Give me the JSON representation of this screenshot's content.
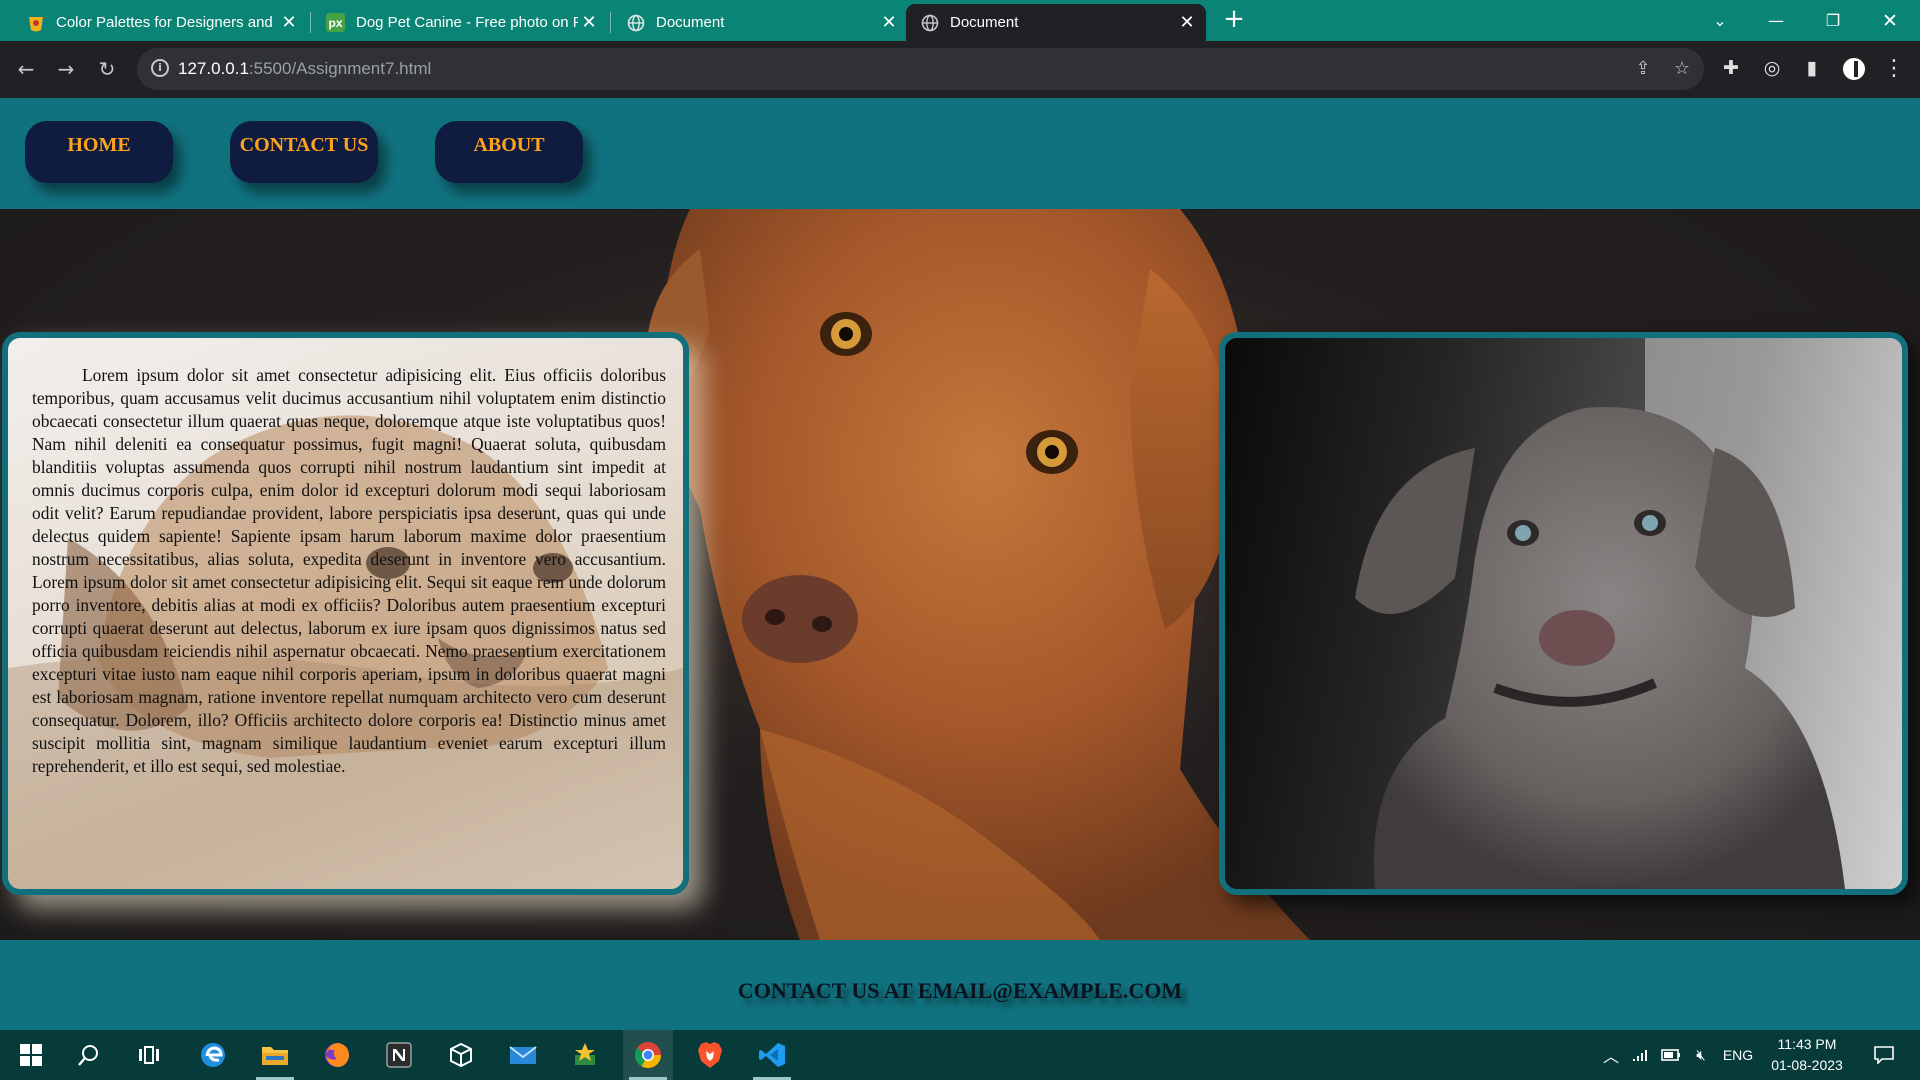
{
  "browser": {
    "tabs": [
      {
        "title": "Color Palettes for Designers and",
        "icon": "coolors-icon"
      },
      {
        "title": "Dog Pet Canine - Free photo on P",
        "icon": "pixabay-icon"
      },
      {
        "title": "Document",
        "icon": "globe-icon"
      },
      {
        "title": "Document",
        "icon": "globe-icon"
      }
    ],
    "url_host": "127.0.0.1",
    "url_path": ":5500/Assignment7.html"
  },
  "site": {
    "nav": [
      "HOME",
      "CONTACT US",
      "ABOUT"
    ],
    "paragraph": "Lorem ipsum dolor sit amet consectetur adipisicing elit. Eius officiis doloribus temporibus, quam accusamus velit ducimus accusantium nihil voluptatem enim distinctio obcaecati consectetur illum quaerat quas neque, doloremque atque iste voluptatibus quos! Nam nihil deleniti ea consequatur possimus, fugit magni! Quaerat soluta, quibusdam blanditiis voluptas assumenda quos corrupti nihil nostrum laudantium sint impedit at omnis ducimus corporis culpa, enim dolor id excepturi dolorum modi sequi laboriosam odit velit? Earum repudiandae provident, labore perspiciatis ipsa deserunt, quas qui unde delectus quidem sapiente! Sapiente ipsam harum laborum maxime dolor praesentium nostrum necessitatibus, alias soluta, expedita deserunt in inventore vero accusantium. Lorem ipsum dolor sit amet consectetur adipisicing elit. Sequi sit eaque rem unde dolorum porro inventore, debitis alias at modi ex officiis? Doloribus autem praesentium excepturi corrupti quaerat deserunt aut delectus, laborum ex iure ipsam quos dignissimos natus sed officia quibusdam reiciendis nihil aspernatur obcaecati. Nemo praesentium exercitationem excepturi vitae iusto nam eaque nihil corporis aperiam, ipsum in doloribus quaerat magni est laboriosam magnam, ratione inventore repellat numquam architecto vero cum deserunt consequatur. Dolorem, illo? Officiis architecto dolore corporis ea! Distinctio minus amet suscipit mollitia sint, magnam similique laudantium eveniet earum excepturi illum reprehenderit, et illo est sequi, sed molestiae.",
    "footer": "CONTACT US AT EMAIL@EXAMPLE.COM"
  },
  "taskbar": {
    "language": "ENG",
    "time": "11:43 PM",
    "date": "01-08-2023"
  },
  "colors": {
    "tab_bar": "#0a8474",
    "site_nav": "#11727f",
    "nav_pill": "#0f1c3f",
    "nav_text": "#ffa21e",
    "card_border": "#11707c",
    "taskbar": "#073b3a"
  }
}
